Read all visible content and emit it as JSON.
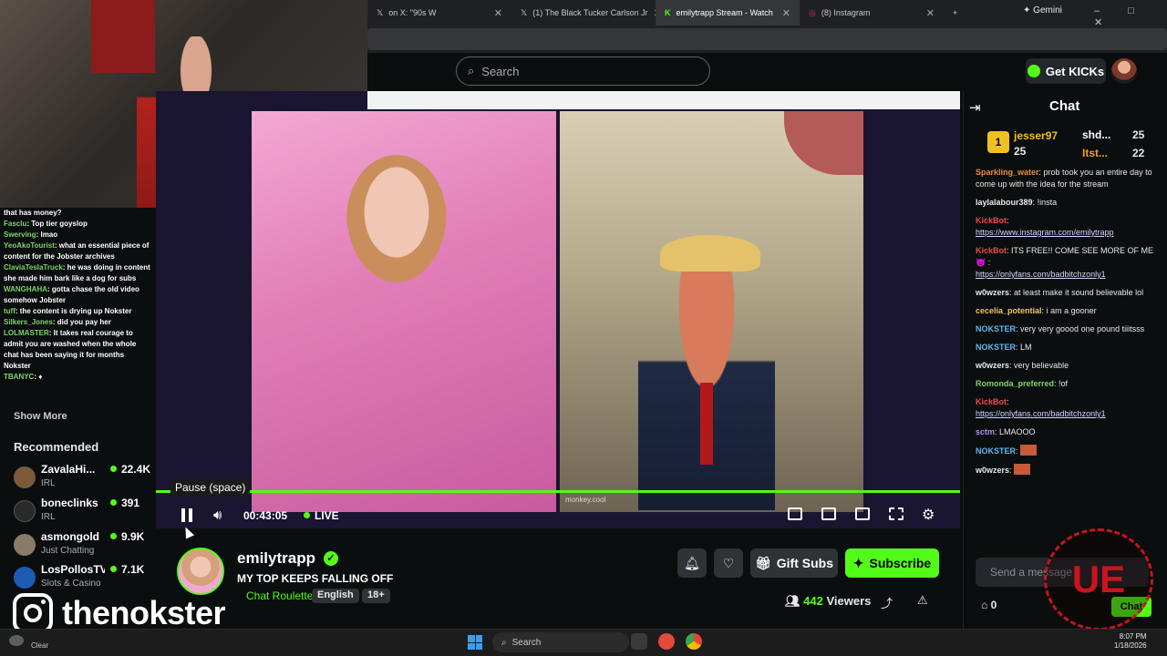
{
  "browser": {
    "tabs": [
      {
        "label": "on X: \"90s W",
        "icon": "x-logo-icon"
      },
      {
        "label": "(1) The Black Tucker Carlson Jr",
        "icon": "x-logo-icon"
      },
      {
        "label": "emilytrapp Stream - Watch",
        "icon": "kick-logo-icon",
        "active": true
      },
      {
        "label": "(8) Instagram",
        "icon": "instagram-icon"
      }
    ],
    "gemini_label": "Gemini",
    "new_tab": "+",
    "window_controls": "– □ ✕"
  },
  "header": {
    "search_placeholder": "Search",
    "get_kicks_label": "Get KICKs"
  },
  "overlay_chat": [
    {
      "user": "",
      "text": "that has money?"
    },
    {
      "user": "Fasclu",
      "text": "Top tier goyslop"
    },
    {
      "user": "Swerving",
      "text": "lmao"
    },
    {
      "user": "YeoAkoTourist",
      "text": "what an essential piece of content for the Jobster archives"
    },
    {
      "user": "ClaviaTeslaTruck",
      "text": "he was doing in content she made him bark like a dog for subs"
    },
    {
      "user": "WANGHAHA",
      "text": "gotta chase the old video somehow Jobster"
    },
    {
      "user": "tuff",
      "text": "the content is drying up Nokster"
    },
    {
      "user": "Silkers_Jones",
      "text": "did you pay her"
    },
    {
      "user": "LOLMASTER",
      "text": "It takes real courage to admit you are washed when the whole chat has been saying it for months Nokster"
    },
    {
      "user": "TBANYC",
      "text": "♦"
    }
  ],
  "sidebar": {
    "show_more": "Show More",
    "recommended_title": "Recommended",
    "recommended": [
      {
        "name": "ZavalaHi...",
        "category": "IRL",
        "viewers": "22.4K",
        "color": "#7a5a3a"
      },
      {
        "name": "boneclinks",
        "category": "IRL",
        "viewers": "391",
        "color": "#2a2a2a"
      },
      {
        "name": "asmongold",
        "category": "Just Chatting",
        "viewers": "9.9K",
        "color": "#8a7a6a"
      },
      {
        "name": "LosPollosTV",
        "category": "Slots & Casino",
        "viewers": "7.1K",
        "color": "#1e5bb5"
      }
    ]
  },
  "instagram_banner": {
    "handle": "thenokster"
  },
  "player": {
    "tooltip": "Pause (space)",
    "time": "00:43:05",
    "live_label": "LIVE",
    "progress": 1.0,
    "overlay_label": "monkey.cool"
  },
  "stream_info": {
    "streamer": "emilytrapp",
    "title": "MY TOP KEEPS FALLING OFF",
    "category": "Chat Roulette",
    "tags": [
      "English",
      "18+"
    ],
    "viewers": "442",
    "viewers_label": "Viewers",
    "gift_subs_label": "Gift Subs",
    "subscribe_label": "Subscribe"
  },
  "chat": {
    "title": "Chat",
    "leaderboard": [
      {
        "name": "jesser97",
        "count": "25"
      },
      {
        "name": "shd...",
        "count": "25"
      },
      {
        "name": "Itst...",
        "count": "22"
      }
    ],
    "messages": [
      {
        "user": "Sparkling_water",
        "color": "#e8903c",
        "text": "prob took you an entire day to come up with the idea for the stream"
      },
      {
        "user": "laylalabour389",
        "color": "#ffffff",
        "text": "!insta"
      },
      {
        "user": "KickBot",
        "color": "#f04848",
        "text": "https://www.instagram.com/emilytrapp",
        "link": true
      },
      {
        "user": "KickBot",
        "color": "#f04848",
        "text": "ITS FREE!! COME SEE MORE OF ME 😈 :"
      },
      {
        "user": "",
        "color": "#ffffff",
        "text": "https://onlyfans.com/badbitchzonly1",
        "link": true
      },
      {
        "user": "w0wzers",
        "color": "#e8e8e8",
        "text": "at least make it sound believable lol"
      },
      {
        "user": "cecelia_potential",
        "color": "#f0c36a",
        "text": "i am a gooner"
      },
      {
        "user": "NOKSTER",
        "color": "#5fb8f0",
        "text": "very very goood one pound tiiitsss"
      },
      {
        "user": "NOKSTER",
        "color": "#5fb8f0",
        "text": "LM"
      },
      {
        "user": "w0wzers",
        "color": "#e8e8e8",
        "text": "very believable"
      },
      {
        "user": "Romonda_preferred",
        "color": "#7fd36b",
        "text": "!of"
      },
      {
        "user": "KickBot",
        "color": "#f04848",
        "text": "https://onlyfans.com/badbitchzonly1",
        "link": true
      },
      {
        "user": "sctm",
        "color": "#b48cf0",
        "text": "LMAOOO"
      },
      {
        "user": "NOKSTER",
        "color": "#5fb8f0",
        "text": ""
      },
      {
        "user": "w0wzers",
        "color": "#e8e8e8",
        "text": ""
      }
    ],
    "input_placeholder": "Send a message",
    "points": "0",
    "chat_button": "Chat"
  },
  "taskbar": {
    "weather": "Clear",
    "search_placeholder": "Search",
    "time": "8:07 PM",
    "date": "1/18/2026"
  },
  "colors": {
    "accent": "#53fc18",
    "background": "#0b0e0f"
  }
}
